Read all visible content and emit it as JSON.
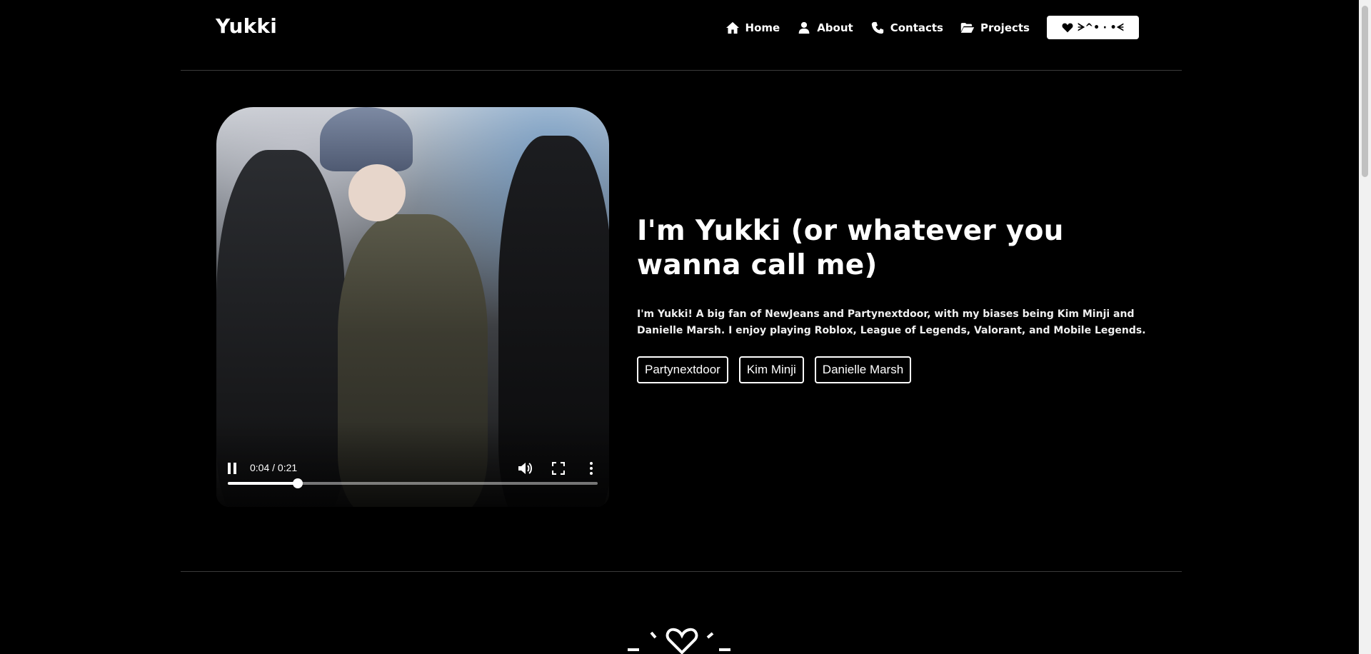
{
  "header": {
    "logo": "Yukki",
    "nav": {
      "home": "Home",
      "about": "About",
      "contacts": "Contacts",
      "projects": "Projects"
    },
    "cta_label": "ᗒ^• ‧ •ᗕ"
  },
  "hero": {
    "video": {
      "current_time": "0:04",
      "duration": "0:21",
      "time_display": "0:04 / 0:21",
      "progress_fraction": 0.19
    },
    "title": "I'm Yukki (or whatever you wanna call me)",
    "description": "I'm Yukki! A big fan of NewJeans and Partynextdoor, with my biases being Kim Minji and Danielle Marsh. I enjoy playing Roblox, League of Legends, Valorant, and Mobile Legends.",
    "tags": [
      "Partynextdoor",
      "Kim Minji",
      "Danielle Marsh"
    ]
  },
  "colors": {
    "background": "#000000",
    "text": "#ffffff",
    "divider": "#3a3a3a"
  },
  "icons": {
    "home": "home-icon",
    "about": "user-icon",
    "contacts": "phone-icon",
    "projects": "folder-open-icon",
    "cta": "heart-icon"
  }
}
